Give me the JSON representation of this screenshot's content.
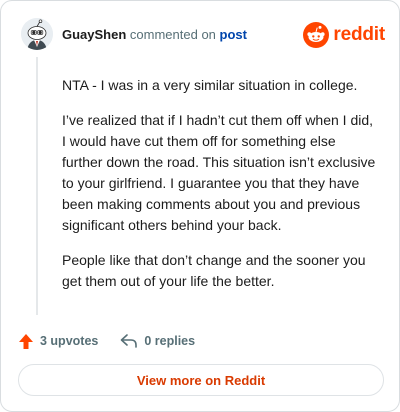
{
  "header": {
    "username": "GuayShen",
    "action_text": "commented on",
    "link_text": "post",
    "brand": "reddit"
  },
  "icons": {
    "avatar": "snoo-avatar-icon",
    "brand": "reddit-logo-icon",
    "upvote": "upvote-arrow-icon",
    "reply": "reply-arrow-icon"
  },
  "colors": {
    "brand": "#ff4500",
    "link": "#0045ac",
    "upvote": "#ff4500",
    "muted": "#576f76",
    "cta": "#d93a00"
  },
  "comment": {
    "paragraphs": [
      "NTA - I was in a very similar situation in college.",
      "I’ve realized that if I hadn’t cut them off when I did, I would have cut them off for something else further down the road. This situation isn’t exclusive to your girlfriend. I guarantee you that they have been making comments about you and previous significant others behind your back.",
      "People like that don’t change and the sooner you get them out of your life the better."
    ]
  },
  "actions": {
    "upvotes": "3 upvotes",
    "replies": "0 replies"
  },
  "cta": {
    "label": "View more on Reddit"
  }
}
